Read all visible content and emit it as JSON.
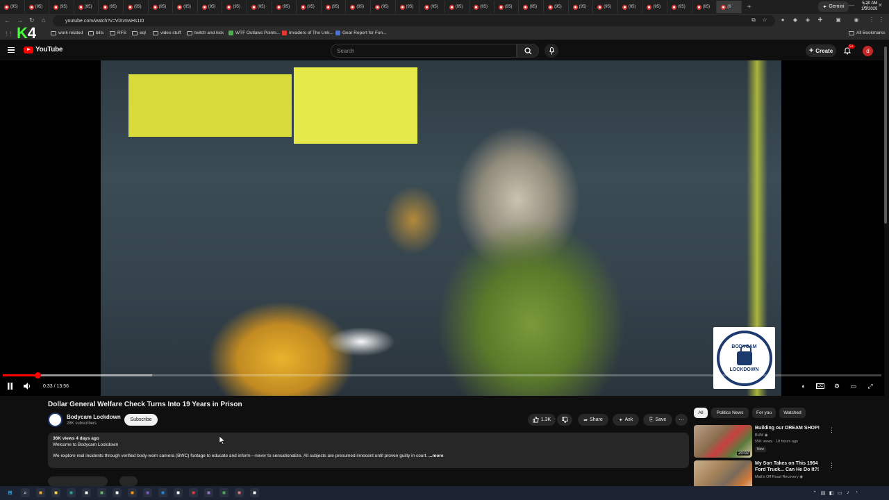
{
  "browser": {
    "tabs": {
      "label": "(95)",
      "active_label": "(6"
    },
    "gemini_label": "Gemini",
    "url": "youtube.com/watch?v=ViXvIIwHs1t0",
    "bookmarks": [
      "work related",
      "bills",
      "RFS",
      "eqI",
      "video stuff",
      "twitch and kick",
      "WTF Outlaws Points...",
      "Invaders of The Unk...",
      "Gear Report for Fon..."
    ],
    "all_bookmarks": "All Bookmarks",
    "overlay_logo": "4"
  },
  "youtube": {
    "logo": "YouTube",
    "search_placeholder": "Search",
    "create_label": "Create",
    "notif_badge": "9+",
    "avatar_letter": "d"
  },
  "player": {
    "time_display": "0:33 / 13:56",
    "played_fraction": 0.04,
    "buffered_fraction": 0.17,
    "watermark_text": [
      "BODYCAM",
      "LOCKDOWN"
    ]
  },
  "video": {
    "title": "Dollar General Welfare Check Turns Into 19 Years in Prison",
    "channel_name": "Bodycam Lockdown",
    "channel_subs": "28K subscribers",
    "subscribe_label": "Subscribe",
    "likes": "1.3K",
    "share_label": "Share",
    "ask_label": "Ask",
    "save_label": "Save",
    "description_meta": "36K views  4 days ago",
    "description_line1": "Welcome to Bodycam Lockdown",
    "description_line2": "We explore real incidents through verified body-worn camera (BWC) footage to educate and inform—never to sensationalize. All subjects are presumed innocent until proven guilty in court.",
    "more_label": "...more"
  },
  "sidebar": {
    "chips": [
      "All",
      "Politics News",
      "For you",
      "Watched"
    ],
    "recommendations": [
      {
        "title": "Building our DREAM SHOP!",
        "channel": "BUM",
        "meta": "55K views · 18 hours ago",
        "badge": "New",
        "duration": "20:02"
      },
      {
        "title": "My Son Takes on This 1964 Ford Truck... Can He Do It?!",
        "channel": "Matt's Off Road Recovery",
        "meta": "",
        "badge": "",
        "duration": ""
      }
    ]
  },
  "taskbar": {
    "time": "5:20 AM",
    "date": "1/5/2026"
  }
}
